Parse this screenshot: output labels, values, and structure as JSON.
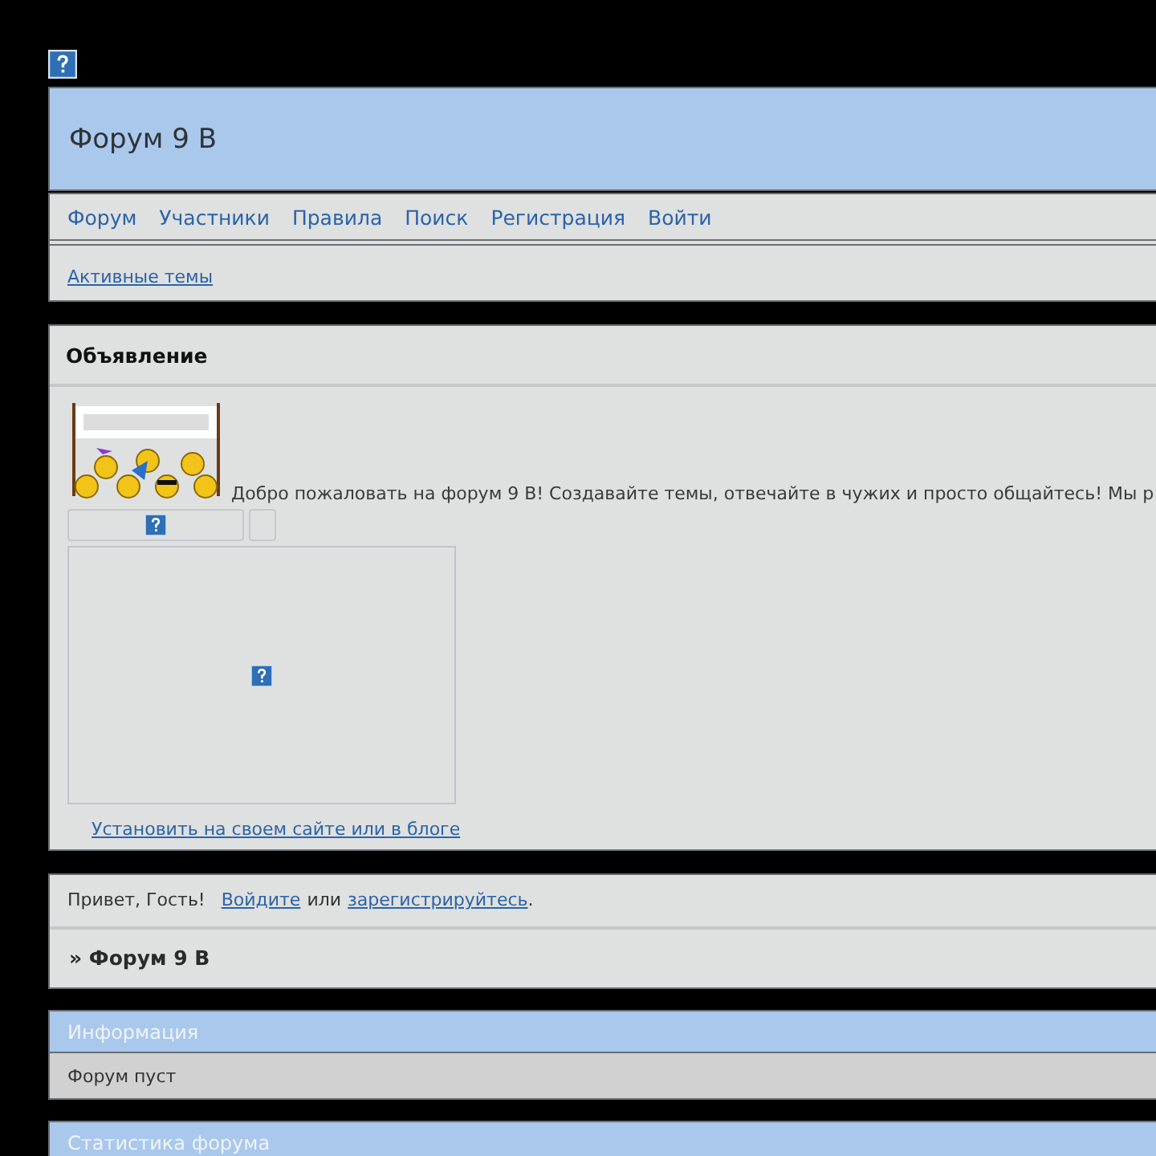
{
  "header": {
    "title": "Форум 9 В"
  },
  "nav": [
    "Форум",
    "Участники",
    "Правила",
    "Поиск",
    "Регистрация",
    "Войти"
  ],
  "subnav": [
    "Активные темы"
  ],
  "announcement": {
    "title": "Объявление",
    "text": "Добро пожаловать на форум 9 В! Создавайте темы, отвечайте в чужих и просто общайтесь! Мы р",
    "install_link": "Установить на своем сайте или в блоге"
  },
  "guest": {
    "greeting": "Привет, Гость!",
    "login": "Войдите",
    "or": "или",
    "register": "зарегистрируйтесь",
    "end": "."
  },
  "breadcrumb": "» Форум 9 В",
  "info": {
    "title": "Информация",
    "text": "Форум пуст"
  },
  "stats": {
    "title": "Статистика форума"
  }
}
